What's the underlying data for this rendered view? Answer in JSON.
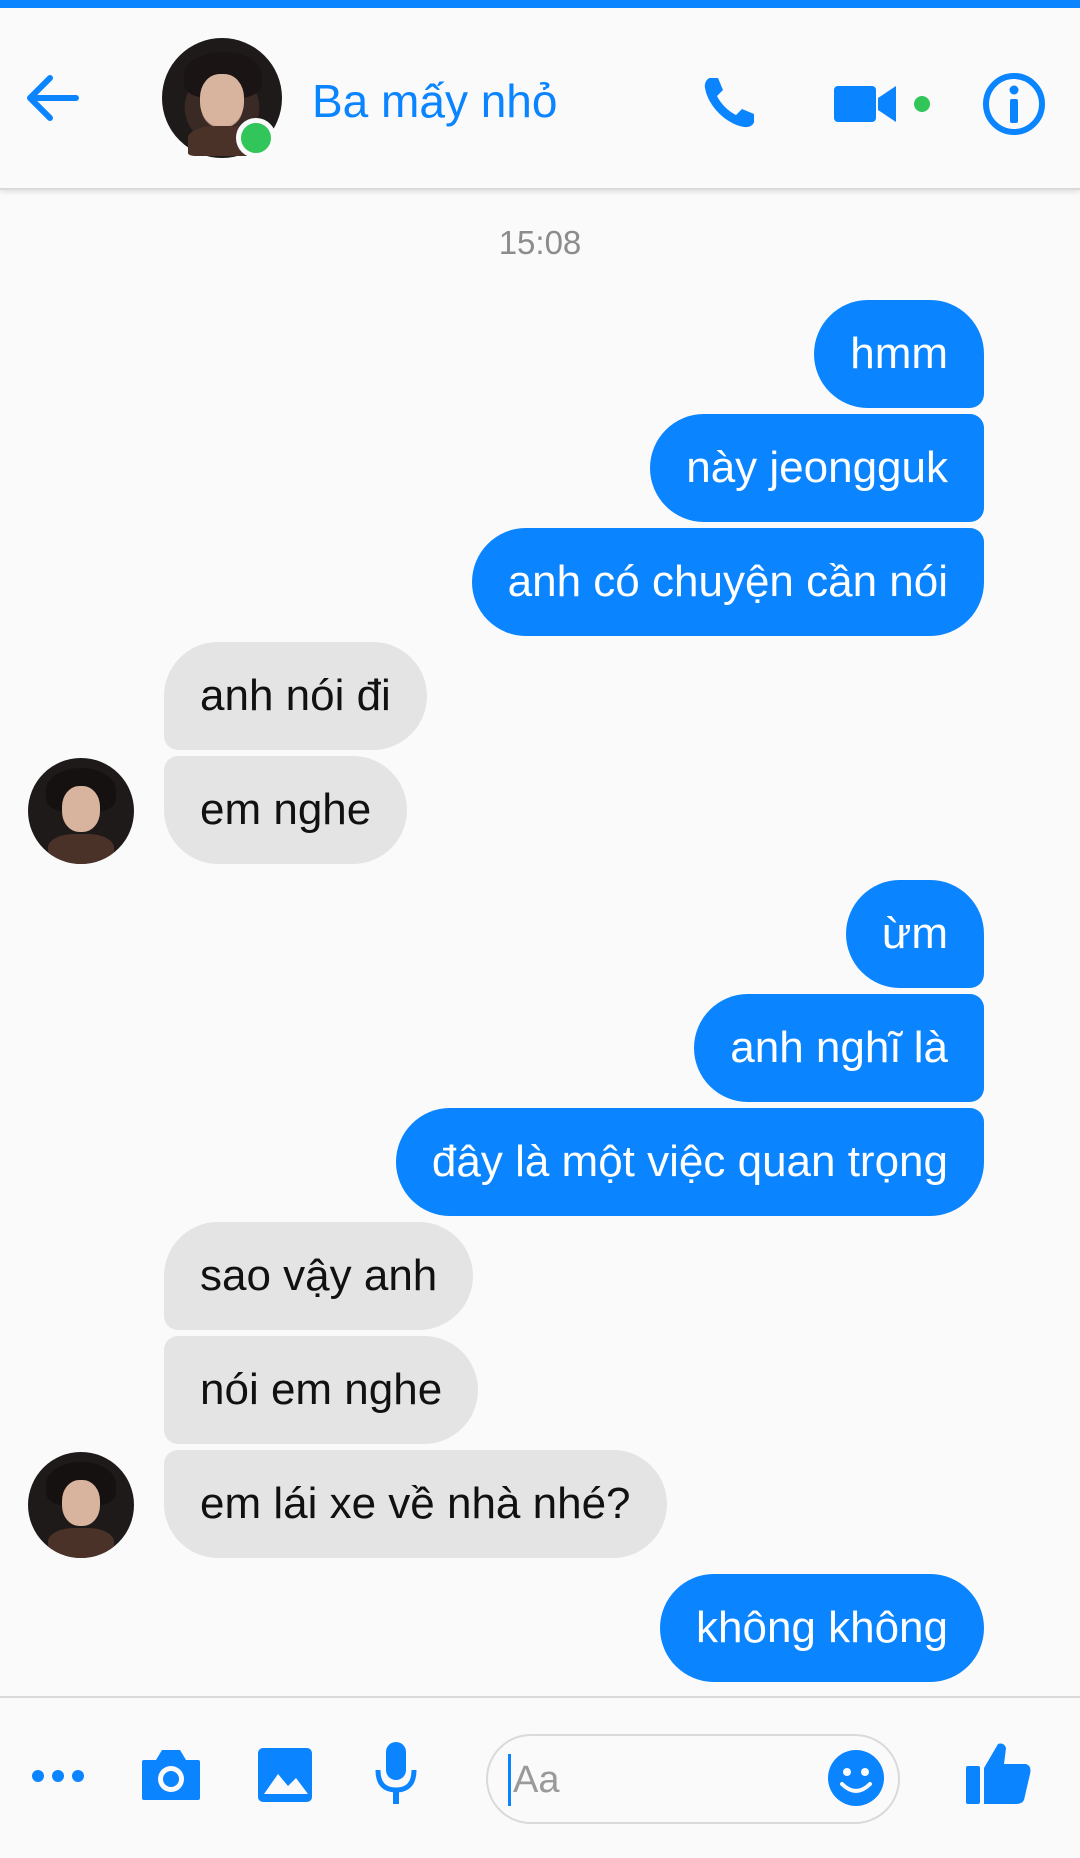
{
  "header": {
    "title": "Ba mấy nhỏ",
    "back_icon": "arrow-left-icon",
    "call_icon": "phone-icon",
    "video_icon": "video-camera-icon",
    "info_icon": "info-icon",
    "contact_online": true
  },
  "chat": {
    "timestamp": "15:08",
    "messages": [
      {
        "from": "me",
        "text": "hmm"
      },
      {
        "from": "me",
        "text": "này jeongguk"
      },
      {
        "from": "me",
        "text": "anh có chuyện cần nói"
      },
      {
        "from": "them",
        "text": "anh nói đi"
      },
      {
        "from": "them",
        "text": "em nghe"
      },
      {
        "from": "me",
        "text": "ừm"
      },
      {
        "from": "me",
        "text": "anh nghĩ là"
      },
      {
        "from": "me",
        "text": "đây là một việc quan trọng"
      },
      {
        "from": "them",
        "text": "sao vậy anh"
      },
      {
        "from": "them",
        "text": "nói em nghe"
      },
      {
        "from": "them",
        "text": "em lái xe về nhà nhé?"
      },
      {
        "from": "me",
        "text": "không không"
      }
    ]
  },
  "composer": {
    "placeholder": "Aa",
    "icons": [
      "more-icon",
      "camera-icon",
      "image-icon",
      "microphone-icon",
      "emoji-icon",
      "like-icon"
    ]
  },
  "colors": {
    "accent": "#0a84ff",
    "incoming_bubble": "#e4e4e4",
    "online": "#31c55a",
    "background": "#fafafa"
  }
}
